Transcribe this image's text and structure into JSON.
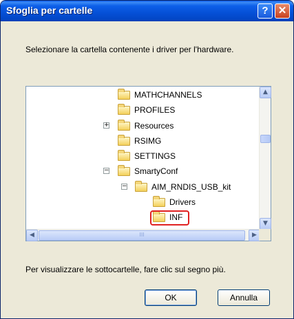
{
  "window": {
    "title": "Sfoglia per cartelle",
    "help_glyph": "?",
    "close_glyph": "✕"
  },
  "instruction": "Selezionare la cartella contenente i driver per l'hardware.",
  "tree": {
    "items": [
      {
        "label": "MATHCHANNELS"
      },
      {
        "label": "PROFILES"
      },
      {
        "label": "Resources",
        "expander": "+"
      },
      {
        "label": "RSIMG"
      },
      {
        "label": "SETTINGS"
      },
      {
        "label": "SmartyConf",
        "expander": "−"
      },
      {
        "label": "AIM_RNDIS_USB_kit",
        "expander": "−"
      },
      {
        "label": "Drivers"
      },
      {
        "label": "INF",
        "highlighted": true
      }
    ],
    "scroll_up_glyph": "▲",
    "scroll_down_glyph": "▼",
    "scroll_left_glyph": "◀",
    "scroll_right_glyph": "▶",
    "hthumb_grip": "III"
  },
  "hint": "Per visualizzare le sottocartelle, fare clic sul segno più.",
  "buttons": {
    "ok": "OK",
    "cancel": "Annulla"
  },
  "colors": {
    "titlebar": "#0550d6",
    "highlight": "#e02020",
    "dialog_bg": "#ece9d8"
  }
}
